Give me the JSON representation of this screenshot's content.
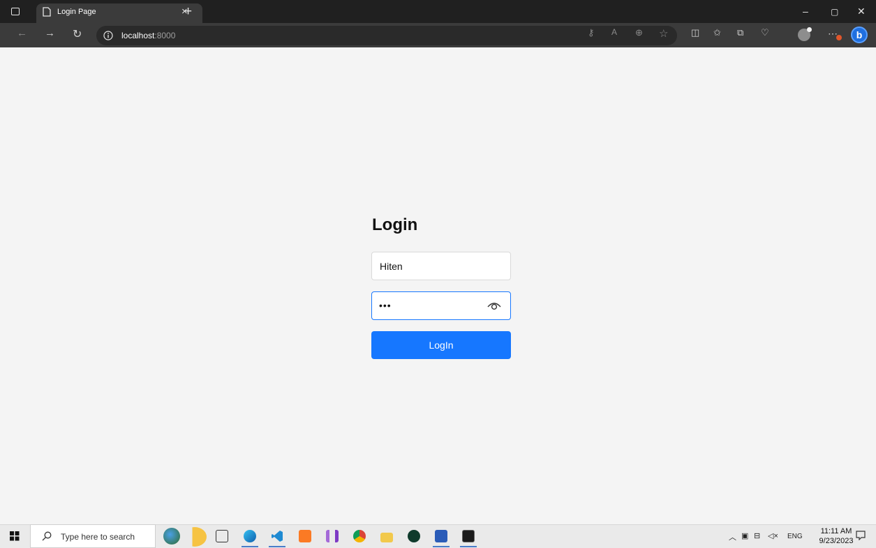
{
  "browser": {
    "tab_title": "Login Page",
    "tab_close": "×",
    "new_tab": "+",
    "url_host": "localhost",
    "url_port": ":8000",
    "window_controls": {
      "minimize": "–",
      "restore": "▢",
      "close": "✕"
    },
    "toolbar_icons": [
      "key-icon",
      "read-aloud-icon",
      "zoom-icon",
      "favorite-star-icon",
      "split-screen-icon",
      "favorites-icon",
      "collections-icon",
      "browser-essentials-icon",
      "profile-icon",
      "more-menu-icon",
      "bing-copilot-icon"
    ]
  },
  "login": {
    "title": "Login",
    "username_value": "Hiten",
    "password_mask": "•••",
    "button_label": "LogIn"
  },
  "taskbar": {
    "search_placeholder": "Type here to search",
    "tray_language": "ENG",
    "clock_time": "11:11 AM",
    "clock_date": "9/23/2023",
    "apps": [
      "widgets",
      "task-view",
      "edge",
      "vscode",
      "xampp",
      "visual-studio",
      "chrome",
      "file-explorer",
      "mongodb-compass",
      "word",
      "terminal"
    ]
  },
  "colors": {
    "accent": "#1677ff",
    "page_background": "#f4f4f4",
    "title_bar": "#202020",
    "toolbar": "#3b3b3b"
  }
}
